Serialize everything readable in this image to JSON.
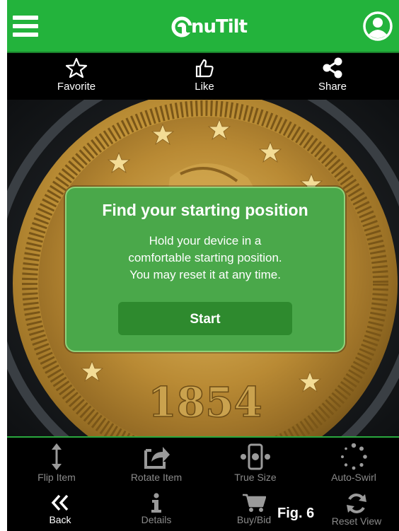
{
  "app": {
    "brand": "nuTilt",
    "menu_icon": "hamburger-menu-icon",
    "profile_icon": "user-profile-icon",
    "brand_color": "#23b33c"
  },
  "actions": [
    {
      "label": "Favorite",
      "icon": "star-icon"
    },
    {
      "label": "Like",
      "icon": "thumbs-up-icon"
    },
    {
      "label": "Share",
      "icon": "share-icon"
    }
  ],
  "viewer": {
    "coin_date": "1854"
  },
  "dialog": {
    "title": "Find your starting position",
    "body_lines": [
      "Hold your device in a",
      "comfortable starting position.",
      "You may reset it at any time."
    ],
    "button": "Start",
    "bg_color": "#4aa84a",
    "button_color": "#2e8a2e"
  },
  "toolbar": {
    "row1": [
      {
        "label": "Flip Item",
        "icon": "flip-vertical-icon"
      },
      {
        "label": "Rotate Item",
        "icon": "rotate-share-icon"
      },
      {
        "label": "True Size",
        "icon": "true-size-icon"
      },
      {
        "label": "Auto-Swirl",
        "icon": "auto-swirl-icon"
      }
    ],
    "row2": [
      {
        "label": "Back",
        "icon": "double-chevron-left-icon"
      },
      {
        "label": "Details",
        "icon": "info-icon"
      },
      {
        "label": "Buy/Bid",
        "icon": "shopping-cart-icon"
      },
      {
        "label": "Reset View",
        "icon": "refresh-icon"
      }
    ]
  },
  "figure_label": "Fig. 6"
}
